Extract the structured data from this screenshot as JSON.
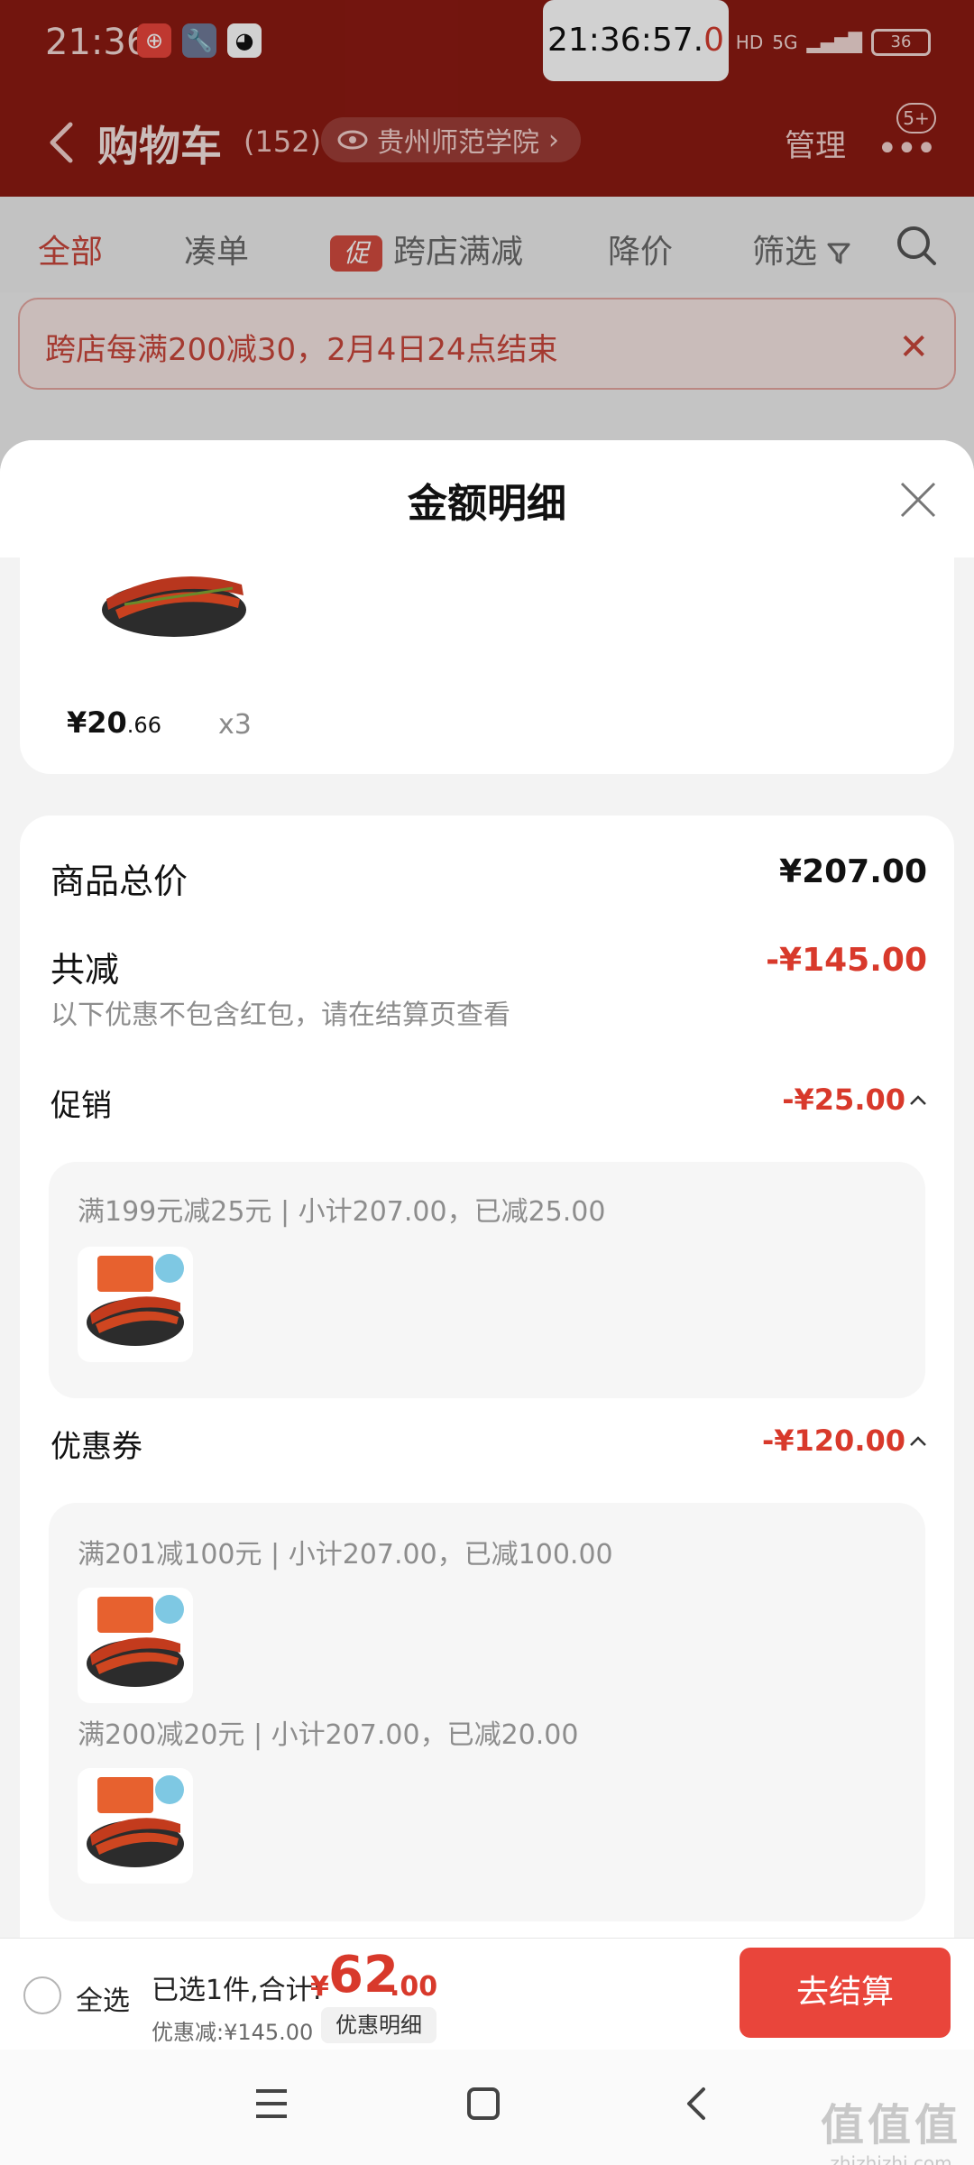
{
  "status_bar": {
    "time": "21:36",
    "clock_main": "21:36:57.",
    "clock_sub": "0",
    "network": "HD",
    "signal": "5G",
    "battery": "36"
  },
  "header": {
    "title": "购物车",
    "count": "(152)",
    "location": "贵州师范学院",
    "manage": "管理",
    "badge": "5+"
  },
  "tabs": {
    "all": "全部",
    "bundle": "凑单",
    "promo_tag": "促",
    "cross_store": "跨店满减",
    "price_drop": "降价",
    "filter": "筛选"
  },
  "notice": {
    "text": "跨店每满200减30，2月4日24点结束"
  },
  "sheet": {
    "title": "金额明细",
    "product": {
      "price_main": "¥20",
      "price_dec": ".66",
      "qty": "x3"
    },
    "total_label": "商品总价",
    "total_value": "¥207.00",
    "discount_label": "共减",
    "discount_value": "-¥145.00",
    "discount_note": "以下优惠不包含红包，请在结算页查看",
    "promo": {
      "label": "促销",
      "value": "-¥25.00",
      "line": "满199元减25元 | 小计207.00，已减25.00"
    },
    "coupon": {
      "label": "优惠券",
      "value": "-¥120.00",
      "line1": "满201减100元 | 小计207.00，已减100.00",
      "line2": "满200减20元 | 小计207.00，已减20.00"
    }
  },
  "bottom_bar": {
    "select_all": "全选",
    "selected_text": "已选1件,合计:",
    "currency": "¥",
    "total_int": "62",
    "total_dec": ".00",
    "discount_line": "优惠减:¥145.00",
    "detail_button": "优惠明细",
    "checkout_button": "去结算"
  },
  "watermark": {
    "logo": "值值值",
    "domain": "zhizhizhi.com"
  },
  "colors": {
    "brand_red": "#8c1a12",
    "accent_red": "#d8392b",
    "checkout_red": "#e9453b"
  }
}
